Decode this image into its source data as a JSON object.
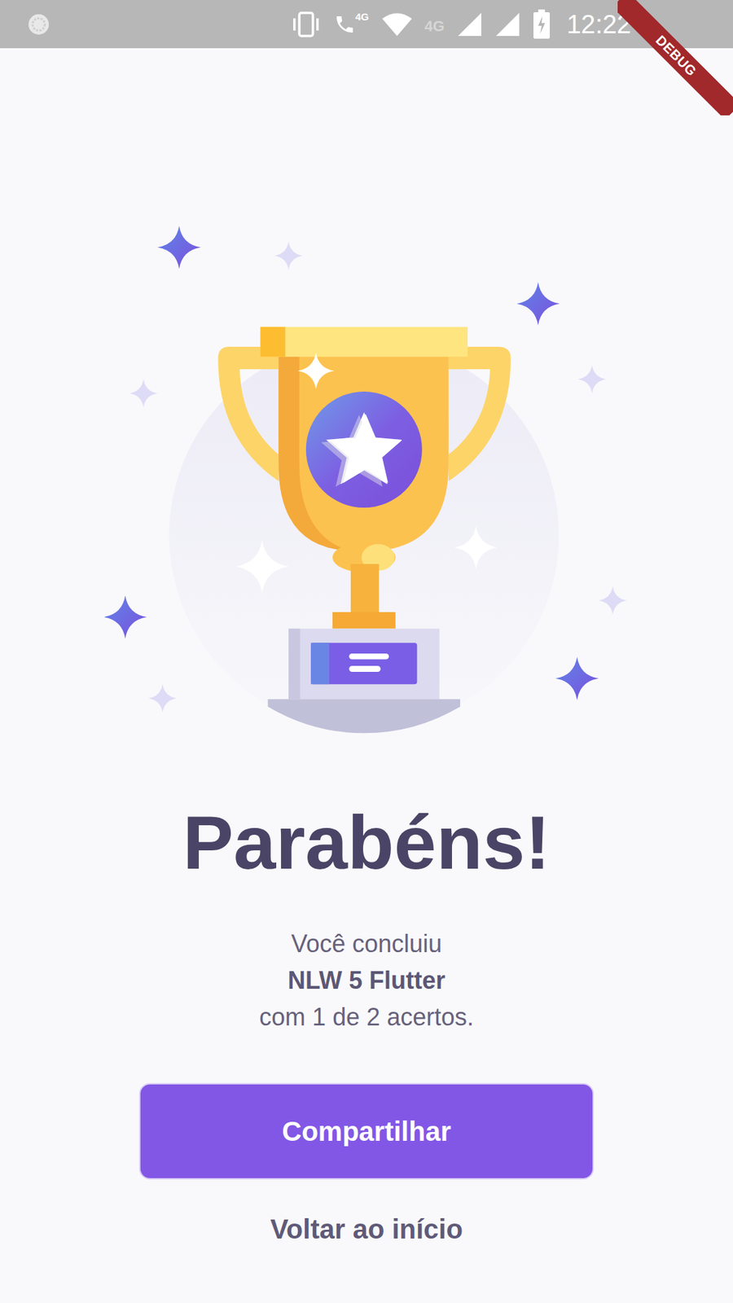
{
  "status_bar": {
    "time": "12:22",
    "call_badge": "4G",
    "network": "4G"
  },
  "debug_banner": "DEBUG",
  "title": "Parabéns!",
  "message": {
    "intro": "Você concluiu",
    "quiz": "NLW 5 Flutter",
    "result": "com 1 de 2 acertos."
  },
  "buttons": [
    {
      "label": "Compartilhar",
      "kind": "primary"
    },
    {
      "label": "Voltar ao início",
      "kind": "link"
    }
  ]
}
